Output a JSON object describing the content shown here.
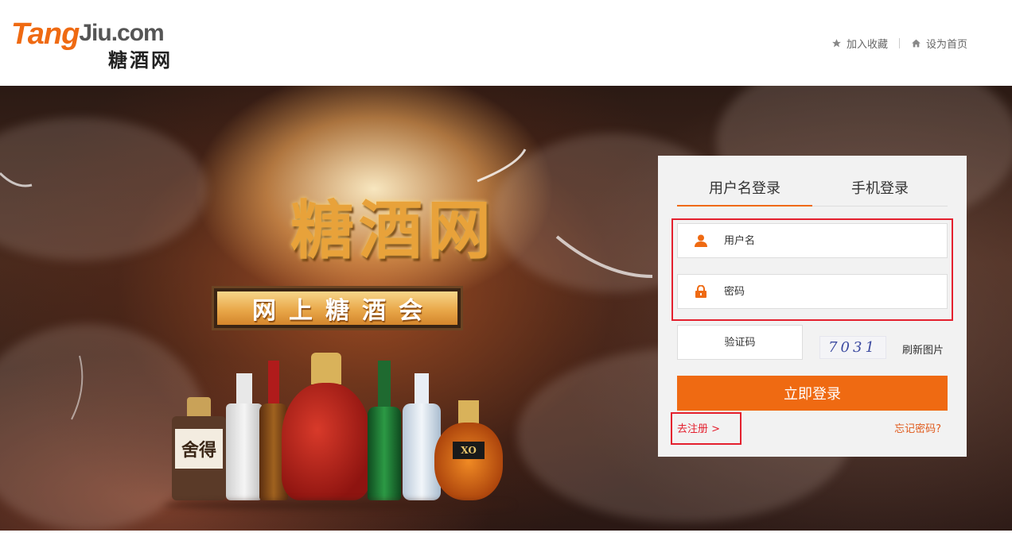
{
  "header": {
    "logo_en_main": "Tang",
    "logo_en_sub": "Jiu.com",
    "logo_cn": "糖酒网",
    "links": [
      {
        "label": "加入收藏",
        "icon": "star-icon"
      },
      {
        "label": "设为首页",
        "icon": "home-icon"
      }
    ]
  },
  "banner": {
    "title": "糖酒网",
    "plaque": "网上糖酒会",
    "bottle_labels": [
      "舍得",
      "XO"
    ]
  },
  "login": {
    "tabs": [
      {
        "label": "用户名登录",
        "active": true
      },
      {
        "label": "手机登录",
        "active": false
      }
    ],
    "username_placeholder": "用户名",
    "password_placeholder": "密码",
    "captcha_placeholder": "验证码",
    "captcha_text": "7031",
    "refresh_label": "刷新图片",
    "submit_label": "立即登录",
    "register_label": "去注册 >",
    "forgot_label": "忘记密码?"
  },
  "colors": {
    "accent": "#ef6a12",
    "highlight_red": "#e4202e"
  }
}
